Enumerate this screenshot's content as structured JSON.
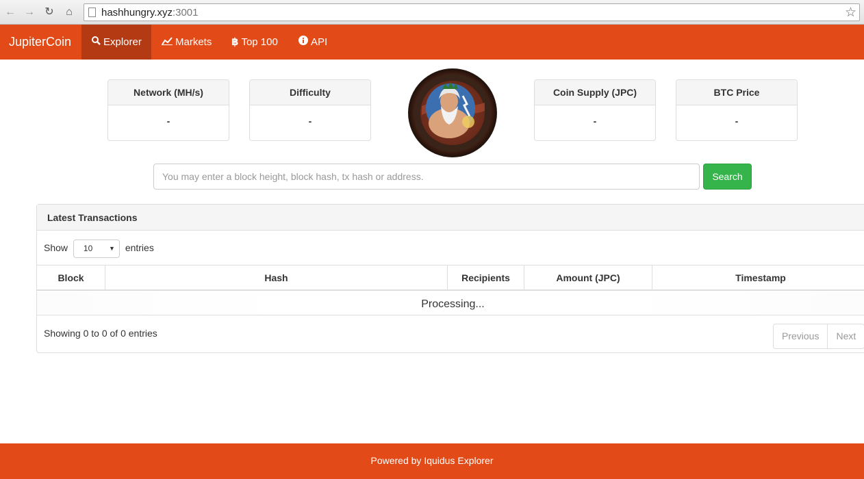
{
  "browser": {
    "url_host": "hashhungry.xyz",
    "url_port": ":3001"
  },
  "navbar": {
    "brand": "JupiterCoin",
    "items": [
      {
        "label": "Explorer",
        "icon": "search-icon",
        "active": true
      },
      {
        "label": "Markets",
        "icon": "chart-icon",
        "active": false
      },
      {
        "label": "Top 100",
        "icon": "bitcoin-icon",
        "active": false
      },
      {
        "label": "API",
        "icon": "info-icon",
        "active": false
      }
    ]
  },
  "stats": {
    "network": {
      "label": "Network (MH/s)",
      "value": "-"
    },
    "difficulty": {
      "label": "Difficulty",
      "value": "-"
    },
    "supply": {
      "label": "Coin Supply (JPC)",
      "value": "-"
    },
    "btc_price": {
      "label": "BTC Price",
      "value": "-"
    }
  },
  "search": {
    "placeholder": "You may enter a block height, block hash, tx hash or address.",
    "button_label": "Search"
  },
  "transactions": {
    "title": "Latest Transactions",
    "show_label": "Show",
    "entries_value": "10",
    "entries_label": "entries",
    "columns": [
      "Block",
      "Hash",
      "Recipients",
      "Amount (JPC)",
      "Timestamp"
    ],
    "processing_text": "Processing...",
    "showing_text": "Showing 0 to 0 of 0 entries",
    "previous_label": "Previous",
    "next_label": "Next"
  },
  "footer": {
    "text": "Powered by Iquidus Explorer"
  },
  "colors": {
    "brand": "#e24a17",
    "brand_active": "#b33a12",
    "search_button": "#34b44a"
  }
}
